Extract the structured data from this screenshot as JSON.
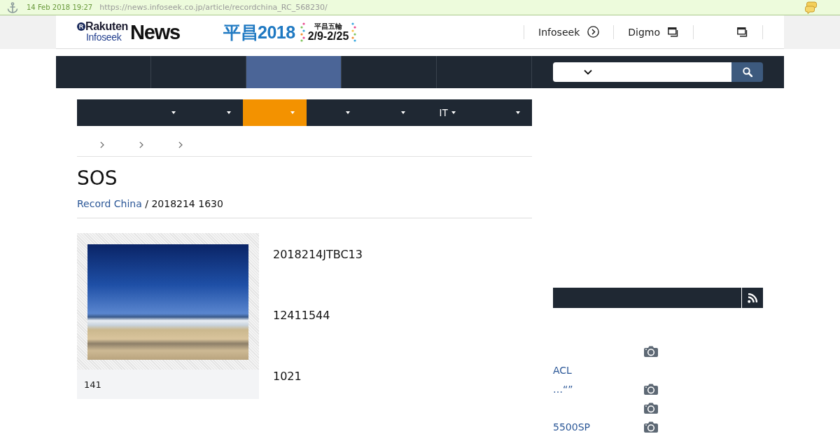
{
  "archive_bar": {
    "date": "14 Feb 2018 19:27",
    "url": "https://news.infoseek.co.jp/article/recordchina_RC_568230/"
  },
  "header": {
    "logo": {
      "badge": "R",
      "brand": "Rakuten",
      "sub": "Infoseek",
      "name": "News"
    },
    "banner": {
      "title": "平昌2018",
      "subtitle": "平昌五輪",
      "dates": "2/9-2/25"
    },
    "links": [
      {
        "label": "Infoseek",
        "kind": "internal"
      },
      {
        "label": "Digmo",
        "kind": "external"
      },
      {
        "kind": "external"
      }
    ]
  },
  "nav": {
    "tabs": [
      {
        "selected": false
      },
      {
        "selected": false
      },
      {
        "selected": true
      },
      {
        "selected": false
      },
      {
        "selected": false
      }
    ]
  },
  "category_menu": [
    {
      "selected": false
    },
    {
      "selected": false
    },
    {
      "selected": true
    },
    {
      "selected": false
    },
    {
      "selected": false
    },
    {
      "label": "IT",
      "selected": false
    },
    {
      "selected": false
    }
  ],
  "article": {
    "title": "SOS",
    "source": "Record China",
    "byline_rest": " / 2018214 1630",
    "photo": {
      "caption": "141"
    },
    "paragraphs": [
      "2018214JTBC13",
      "12411544",
      "1021"
    ]
  },
  "sidebar": {
    "ranking": [
      {
        "has_photo": true
      },
      {
        "label": "ACL",
        "has_photo": false
      },
      {
        "label": "…“”",
        "has_photo": true
      },
      {
        "has_photo": true
      },
      {
        "label": "5500SP",
        "has_photo": true
      }
    ]
  }
}
